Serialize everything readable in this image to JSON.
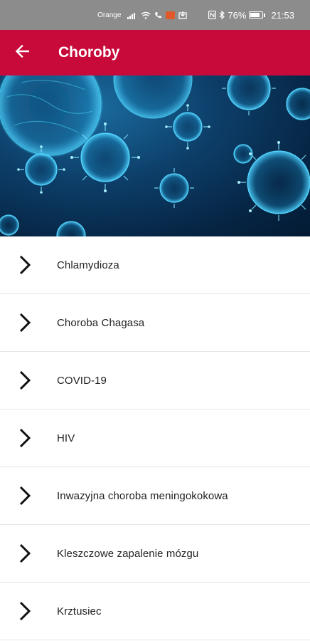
{
  "status_bar": {
    "carrier": "Orange",
    "battery_percent": "76%",
    "time": "21:53"
  },
  "header": {
    "title": "Choroby"
  },
  "diseases": [
    {
      "label": "Chlamydioza"
    },
    {
      "label": "Choroba Chagasa"
    },
    {
      "label": "COVID-19"
    },
    {
      "label": "HIV"
    },
    {
      "label": "Inwazyjna choroba meningokokowa"
    },
    {
      "label": "Kleszczowe zapalenie mózgu"
    },
    {
      "label": "Krztusiec"
    }
  ],
  "colors": {
    "app_bar": "#c70a3a",
    "status_bar": "#8c8c8c",
    "virus_glow": "#35c6f0"
  }
}
